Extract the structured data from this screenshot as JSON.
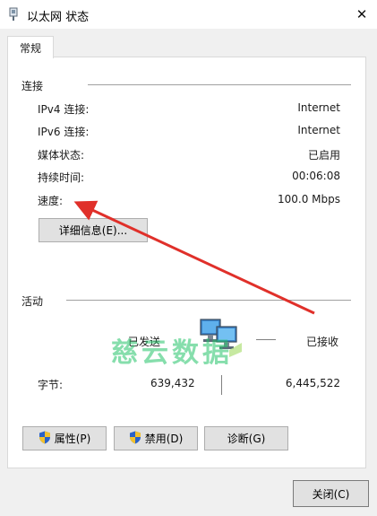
{
  "window": {
    "title": "以太网 状态",
    "close_glyph": "✕"
  },
  "tabs": [
    {
      "label": "常规"
    }
  ],
  "connection": {
    "title": "连接",
    "rows": [
      {
        "label": "IPv4 连接:",
        "value": "Internet"
      },
      {
        "label": "IPv6 连接:",
        "value": "Internet"
      },
      {
        "label": "媒体状态:",
        "value": "已启用"
      },
      {
        "label": "持续时间:",
        "value": "00:06:08"
      },
      {
        "label": "速度:",
        "value": "100.0 Mbps"
      }
    ],
    "details_button": "详细信息(E)..."
  },
  "activity": {
    "title": "活动",
    "sent_label": "已发送",
    "received_label": "已接收",
    "bytes_label": "字节:",
    "bytes_sent": "639,432",
    "bytes_received": "6,445,522",
    "icon": "network-computers-icon"
  },
  "buttons": {
    "properties": "属性(P)",
    "disable": "禁用(D)",
    "diagnose": "诊断(G)",
    "close": "关闭(C)"
  },
  "watermark": "慈云数据",
  "colors": {
    "annotation_arrow": "#e0302a",
    "watermark": "#25c46a",
    "shield_blue": "#2a62c9",
    "shield_yellow": "#f2c12e"
  }
}
